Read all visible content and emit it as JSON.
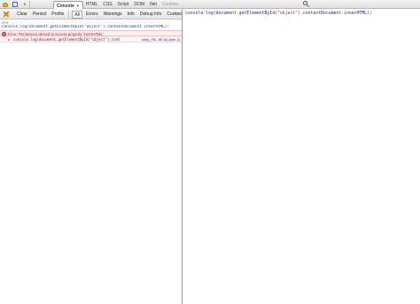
{
  "toolbar": {
    "tabs": [
      {
        "label": "Console",
        "active": true
      },
      {
        "label": "HTML"
      },
      {
        "label": "CSS"
      },
      {
        "label": "Script"
      },
      {
        "label": "DOM"
      },
      {
        "label": "Net"
      },
      {
        "label": "Cookies",
        "disabled": true
      }
    ],
    "search": {
      "value": ""
    },
    "icons": [
      "firebug-icon",
      "inspect-icon",
      "back-arrow-icon",
      "search-icon",
      "dropdown-arrow-icon"
    ]
  },
  "console_toolbar": {
    "buttons": [
      "Clear",
      "Persist",
      "Profile"
    ],
    "filters": [
      "All",
      "Errors",
      "Warnings",
      "Info",
      "Debug Info",
      "Cookies"
    ],
    "selected_filter": "All",
    "icons": [
      "clear-console-icon"
    ]
  },
  "log": {
    "prompt_echo": ">>>",
    "command": "console.log(document.getElementById(\"object\").contentDocument.innerHTML);",
    "error": {
      "message": "Error: Permission denied to access property 'innerHTML'",
      "detail_code": "console.log(document.getElementById(\"object\").cont",
      "source": "with(_FB...8E.it)) (line 2)"
    },
    "icons": [
      "error-icon",
      "expand-arrow-icon"
    ]
  },
  "editor": {
    "code_prefix": "console.log(document.getElementById(",
    "code_string": "\"object\"",
    "code_suffix": ").contentDocument.innerHTML);"
  },
  "colors": {
    "error_text": "#c31515",
    "error_bg": "#fff0f0",
    "code_blue": "#1a2aa0",
    "string_magenta": "#b0166a"
  }
}
